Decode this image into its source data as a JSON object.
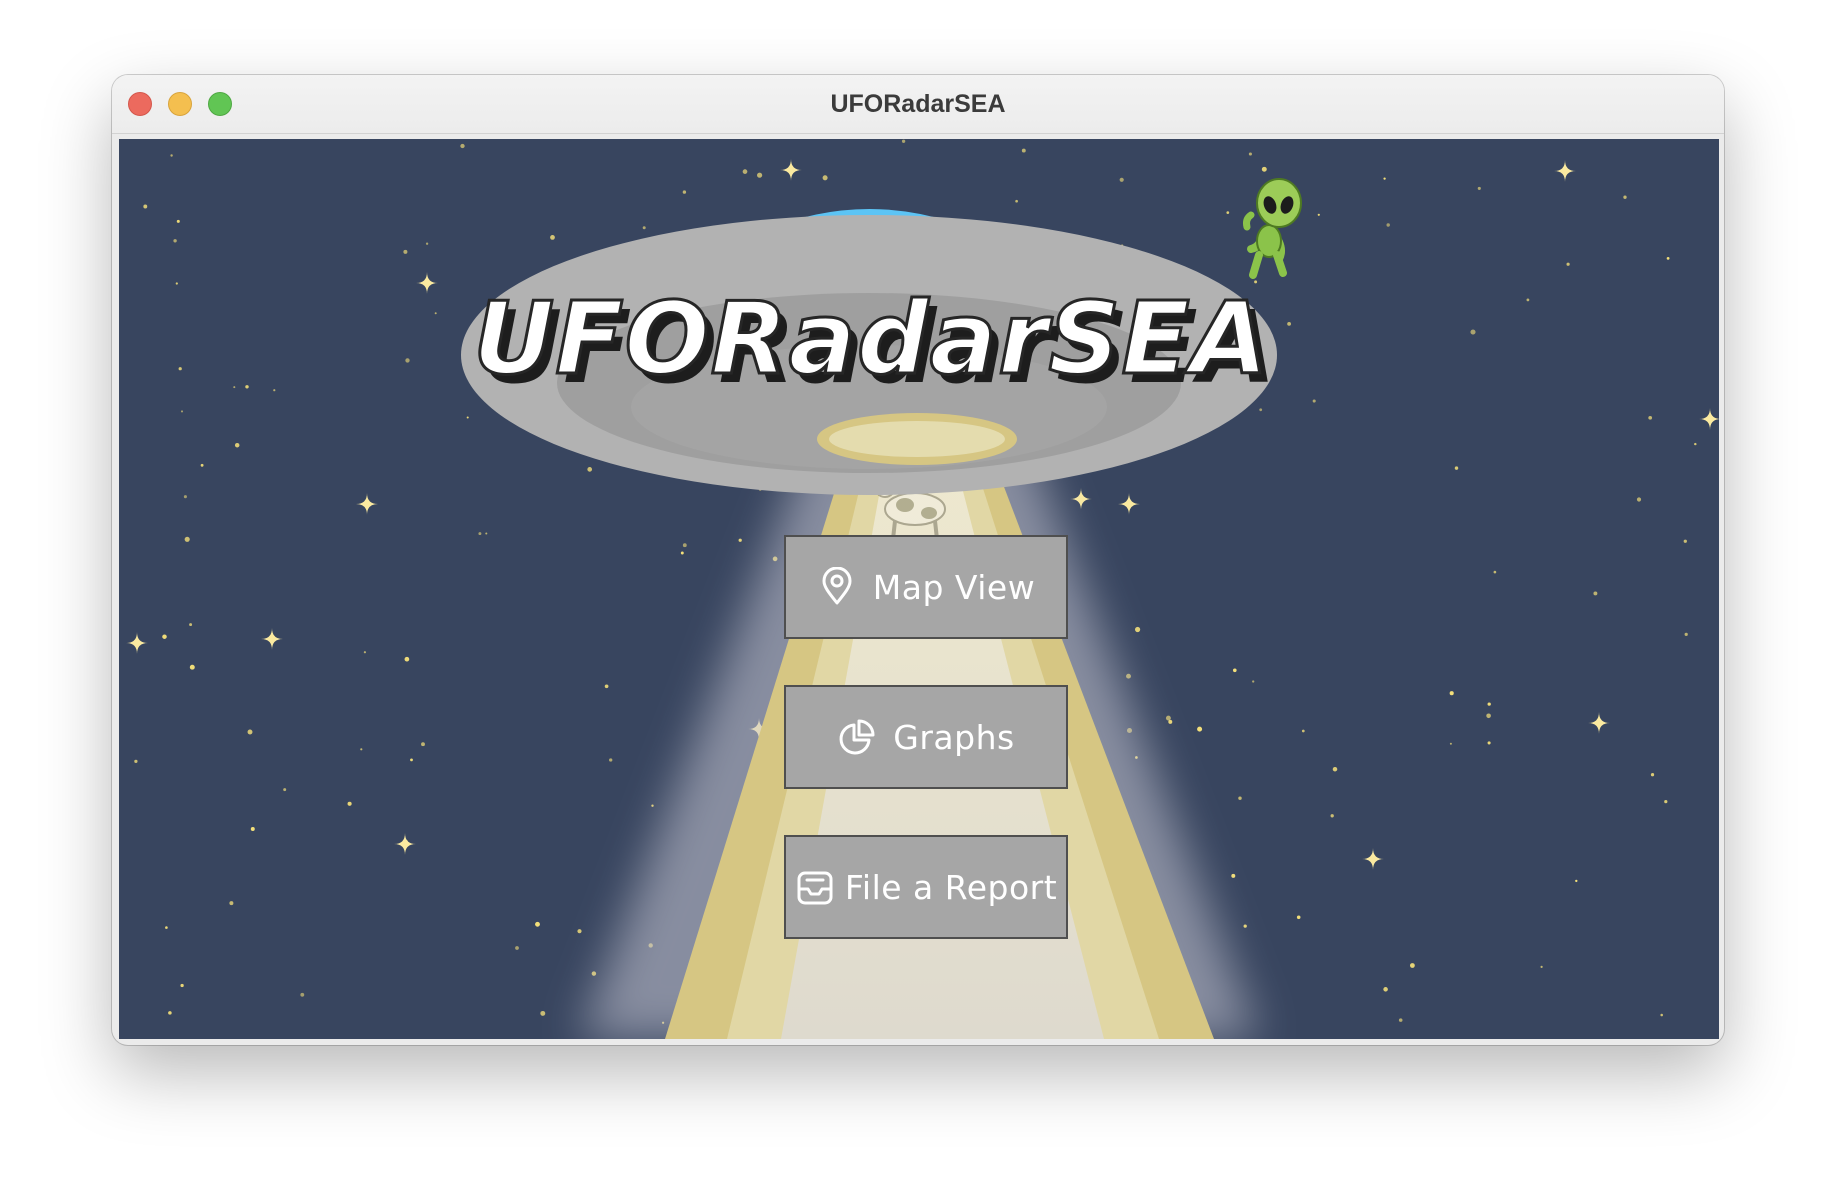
{
  "window": {
    "title": "UFORadarSEA"
  },
  "hero": {
    "logo_text": "UFORadarSEA"
  },
  "menu": {
    "buttons": [
      {
        "label": "Map View",
        "icon": "map-pin-icon"
      },
      {
        "label": "Graphs",
        "icon": "pie-chart-icon"
      },
      {
        "label": "File a Report",
        "icon": "inbox-tray-icon"
      }
    ]
  },
  "colors": {
    "background": "#38455f",
    "saucer_dome": "#5cc4f5",
    "saucer_body": "#b0b0b0",
    "beam": "#d4c584",
    "alien": "#8bc34a",
    "button": "#a6a6a6",
    "stars": "#f7e27a"
  }
}
